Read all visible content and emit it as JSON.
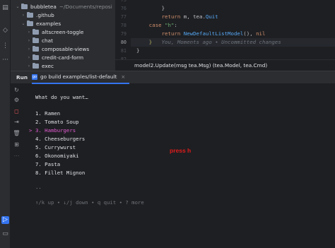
{
  "project_tree": {
    "root": {
      "name": "bubbletea",
      "path": "~/Documents/reposi"
    },
    "items": [
      {
        "label": ".github",
        "expanded": false
      },
      {
        "label": "examples",
        "expanded": true
      },
      {
        "label": "altscreen-toggle",
        "expanded": false
      },
      {
        "label": "chat",
        "expanded": false
      },
      {
        "label": "composable-views",
        "expanded": false
      },
      {
        "label": "credit-card-form",
        "expanded": false
      },
      {
        "label": "exec",
        "expanded": false
      }
    ]
  },
  "editor": {
    "lines": [
      {
        "num": "76",
        "code": "        }"
      },
      {
        "num": "77",
        "code": "        return m, tea.Quit"
      },
      {
        "num": "78",
        "code": "    case \"h\":"
      },
      {
        "num": "79",
        "code": "        return NewDefaultListModel(), nil"
      },
      {
        "num": "80",
        "code": "    }",
        "hint": "You, Moments ago • Uncommitted changes"
      },
      {
        "num": "81",
        "code": "}"
      },
      {
        "num": "82",
        "code": ""
      }
    ],
    "top_partial_num": "75"
  },
  "breadcrumb": "model2.Update(msg tea.Msg) (tea.Model, tea.Cmd)",
  "run_panel": {
    "label": "Run",
    "tab_label": "go build examples/list-default"
  },
  "console": {
    "prompt": "What do you want…",
    "items": [
      {
        "text": "1. Ramen",
        "selected": false
      },
      {
        "text": "2. Tomato Soup",
        "selected": false
      },
      {
        "text": "3. Hamburgers",
        "selected": true
      },
      {
        "text": "4. Cheeseburgers",
        "selected": false
      },
      {
        "text": "5. Currywurst",
        "selected": false
      },
      {
        "text": "6. Okonomiyaki",
        "selected": false
      },
      {
        "text": "7. Pasta",
        "selected": false
      },
      {
        "text": "8. Fillet Mignon",
        "selected": false
      }
    ],
    "selection_marker": ">",
    "pagination": "..",
    "help": "↑/k up • ↓/j down • q quit • ? more",
    "annotation": "press h"
  },
  "colors": {
    "selected": "#e35ad2",
    "annotation": "#e01b1b",
    "accent": "#3574f0"
  }
}
